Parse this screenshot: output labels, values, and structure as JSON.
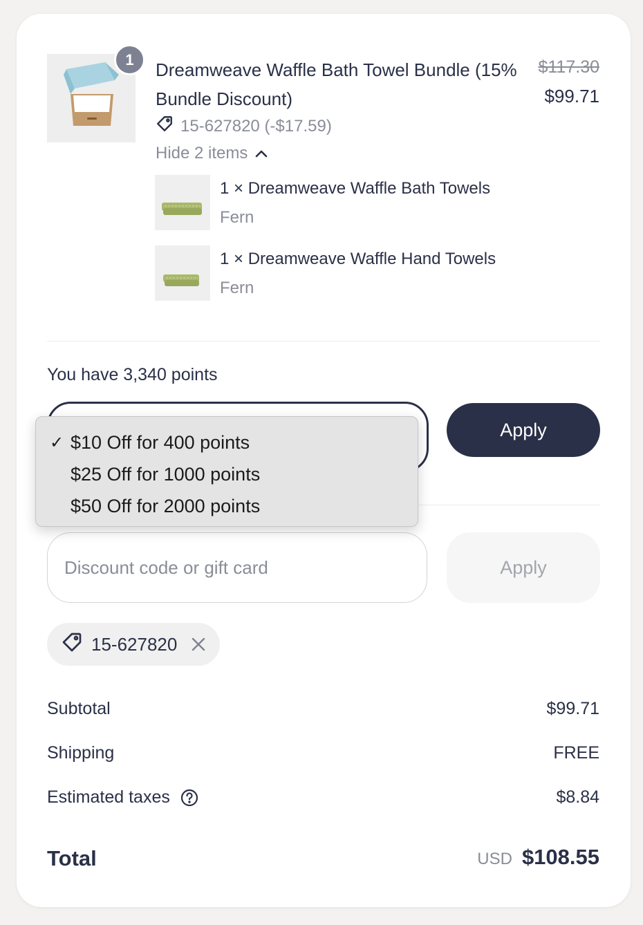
{
  "product": {
    "quantity_badge": "1",
    "title": "Dreamweave Waffle Bath Towel Bundle (15% Bundle Discount)",
    "price_original": "$117.30",
    "price_final": "$99.71",
    "discount_text": "15-627820 (-$17.59)",
    "toggle_label": "Hide 2 items",
    "sub_items": [
      {
        "name": "1 × Dreamweave Waffle Bath Towels",
        "variant": "Fern"
      },
      {
        "name": "1 × Dreamweave Waffle Hand Towels",
        "variant": "Fern"
      }
    ]
  },
  "rewards": {
    "points_text": "You have 3,340 points",
    "apply_label": "Apply",
    "options": [
      {
        "label": "$10 Off for 400 points",
        "selected": true
      },
      {
        "label": "$25 Off for 1000 points",
        "selected": false
      },
      {
        "label": "$50 Off for 2000 points",
        "selected": false
      }
    ],
    "check_mark": "✓"
  },
  "discount": {
    "placeholder": "Discount code or gift card",
    "apply_label": "Apply",
    "applied_code": "15-627820"
  },
  "summary": {
    "subtotal_label": "Subtotal",
    "subtotal_value": "$99.71",
    "shipping_label": "Shipping",
    "shipping_value": "FREE",
    "taxes_label": "Estimated taxes",
    "taxes_value": "$8.84",
    "total_label": "Total",
    "currency": "USD",
    "total_value": "$108.55"
  },
  "colors": {
    "navy": "#2a3047",
    "muted": "#8a8d98",
    "towel_green": "#a9b86a"
  }
}
